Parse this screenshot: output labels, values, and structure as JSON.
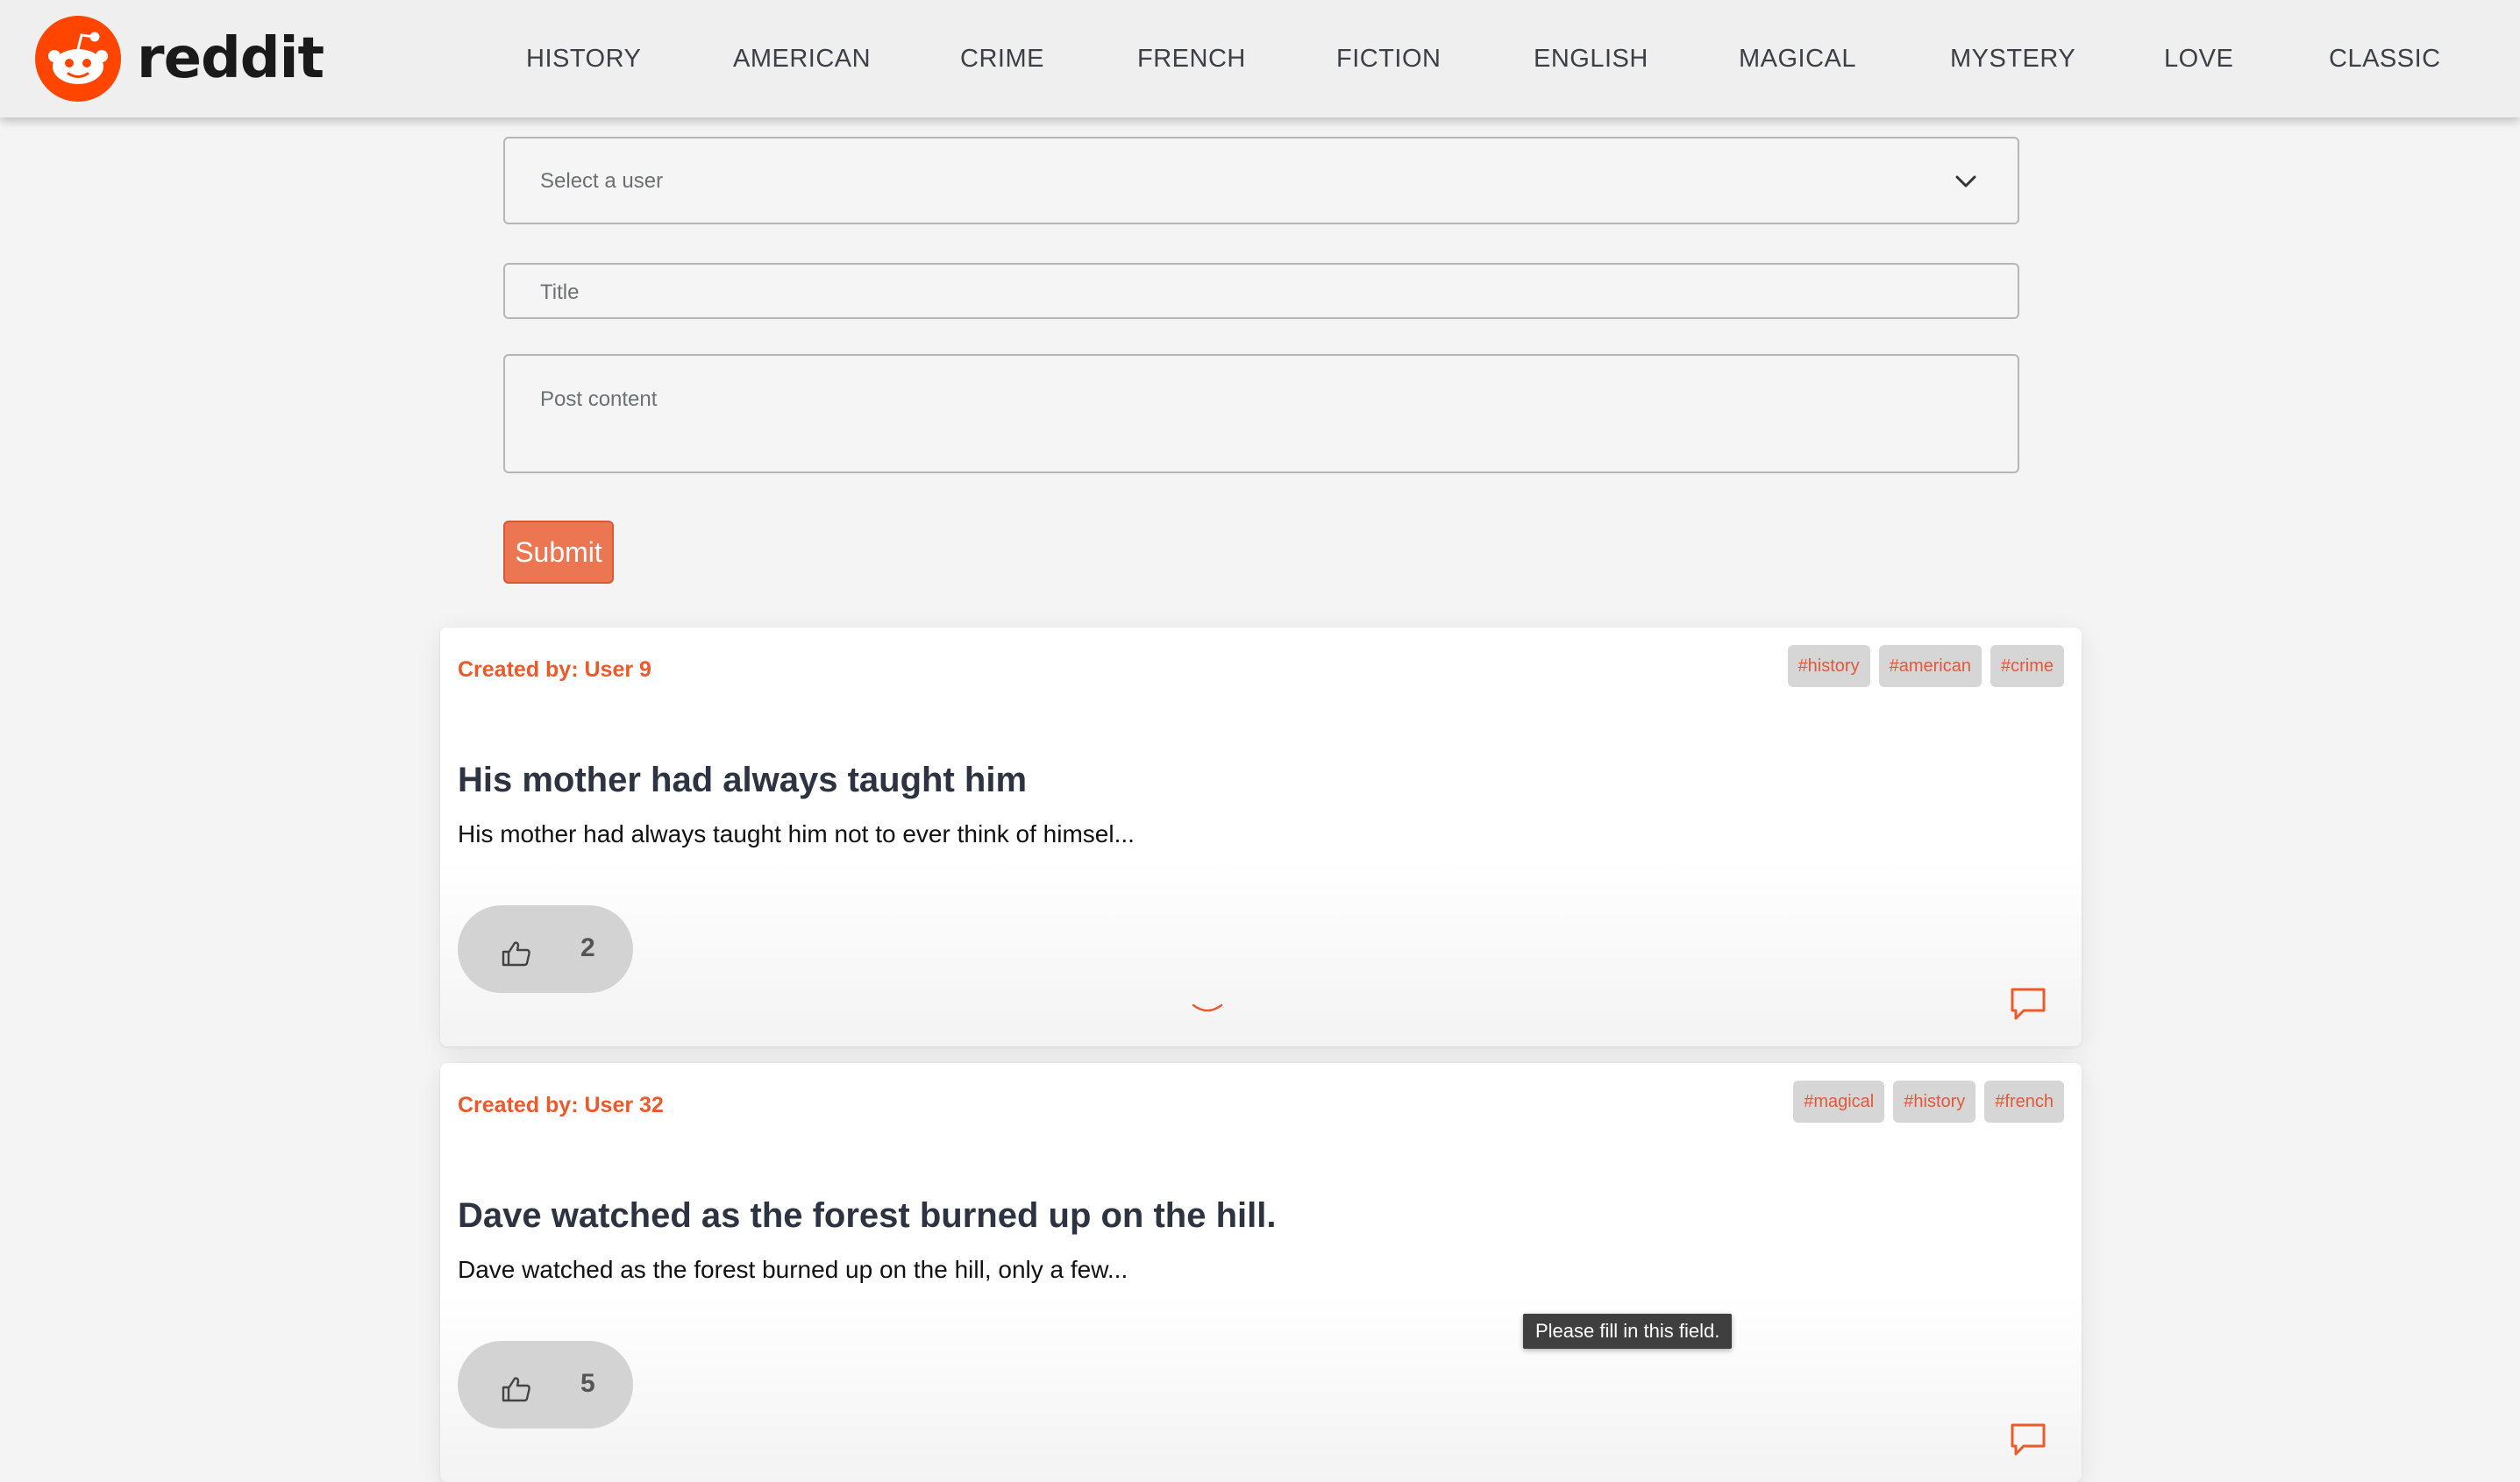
{
  "brand": {
    "name": "reddit",
    "color": "#ff4500"
  },
  "nav": {
    "items": [
      "HISTORY",
      "AMERICAN",
      "CRIME",
      "FRENCH",
      "FICTION",
      "ENGLISH",
      "MAGICAL",
      "MYSTERY",
      "LOVE",
      "CLASSIC"
    ]
  },
  "form": {
    "user_select_placeholder": "Select a user",
    "title_placeholder": "Title",
    "content_placeholder": "Post content",
    "submit_label": "Submit"
  },
  "posts": [
    {
      "author": "Created by: User 9",
      "tags": [
        "#history",
        "#american",
        "#crime"
      ],
      "title": "His mother had always taught him",
      "excerpt": "His mother had always taught him not to ever think of himsel...",
      "likes": "2"
    },
    {
      "author": "Created by: User 32",
      "tags": [
        "#magical",
        "#history",
        "#french"
      ],
      "title": "Dave watched as the forest burned up on the hill.",
      "excerpt": "Dave watched as the forest burned up on the hill, only a few...",
      "likes": "5"
    }
  ],
  "tooltip": {
    "text": "Please fill in this field."
  },
  "colors": {
    "accent": "#ea5a2a",
    "button": "#ed7652",
    "tag_bg": "#d6d6d6"
  }
}
